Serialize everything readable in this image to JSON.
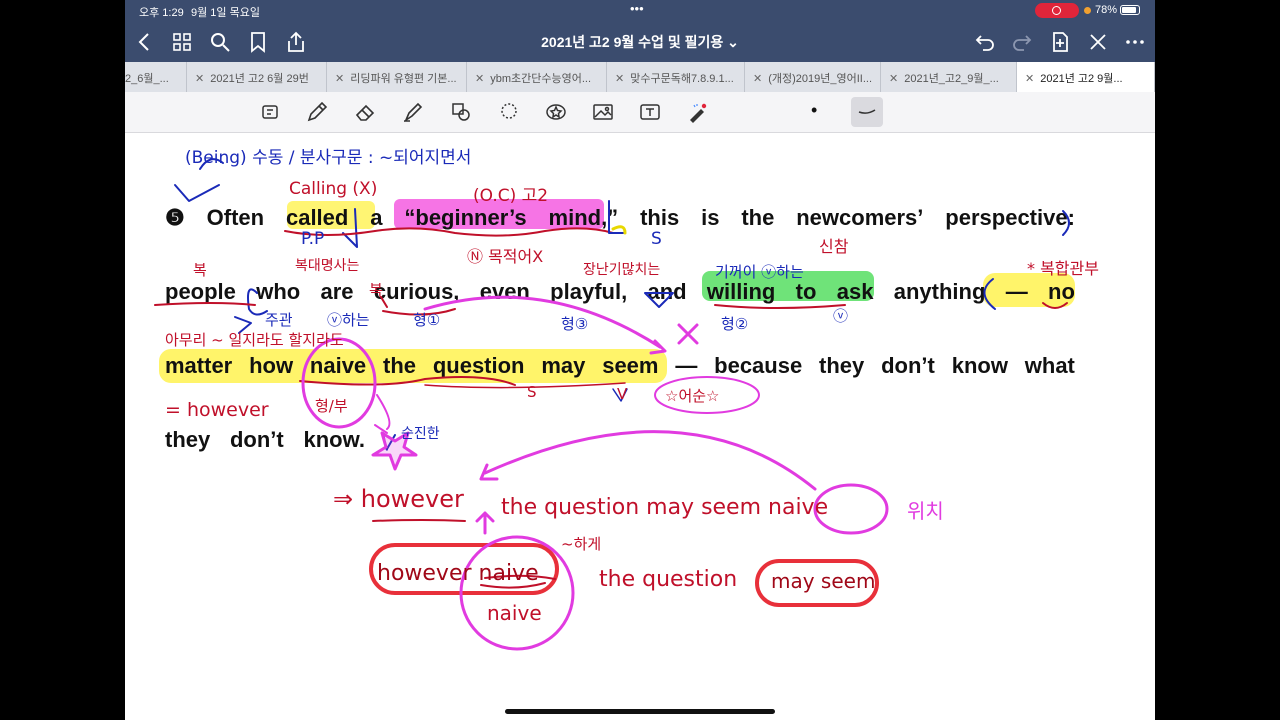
{
  "status": {
    "time": "오후 1:29",
    "date": "9월 1일 목요일",
    "battery": "78%",
    "dots": "•••"
  },
  "doc": {
    "title": "2021년 고2 9월 수업 및 필기용",
    "title_caret": "⌄"
  },
  "tabs": [
    {
      "label": "2_6월_..."
    },
    {
      "label": "2021년 고2 6월 29번"
    },
    {
      "label": "리딩파워 유형편 기본..."
    },
    {
      "label": "ybm초간단수능영어..."
    },
    {
      "label": "맞수구문독해7.8.9.1..."
    },
    {
      "label": "(개정)2019년_영어II..."
    },
    {
      "label": "2021년_고2_9월_..."
    },
    {
      "label": "2021년 고2 9월..."
    }
  ],
  "toolbar": {
    "dot": "•"
  },
  "passage": {
    "line1": [
      "❺",
      "Often",
      "called",
      "a",
      "“beginner’s",
      "mind,”",
      "this",
      "is",
      "the",
      "newcomers’",
      "perspective:"
    ],
    "line2": [
      "people",
      "who",
      "are",
      "curious,",
      "even",
      "playful,",
      "and",
      "willing",
      "to",
      "ask",
      "anything",
      "—",
      "no"
    ],
    "line3": [
      "matter",
      "how",
      "naive",
      "the",
      "question",
      "may",
      "seem",
      "—",
      "because",
      "they",
      "don’t",
      "know",
      "what"
    ],
    "line4": [
      "they",
      "don’t",
      "know."
    ]
  },
  "annotations": {
    "being": "(Being) 수동 / 분사구문 : ~되어지면서",
    "calling": "Calling (X)",
    "pp": "P.P",
    "oc": "(O.C) 고2",
    "n_mark": "Ⓝ 목적어X",
    "s_mark": "S",
    "shinchak": "신참",
    "bokhap": "* 복합관부",
    "buk": "복",
    "buk2": "복",
    "bokdae": "복대명사는",
    "jangnan": "장난기많치는",
    "kigeoi": "기꺼이 ⓥ하는",
    "juhwan": "주관",
    "vhaneun": "ⓥ하는",
    "hyeong1": "형①",
    "hyeong2": "형②",
    "hyeong3": "형③",
    "v_circ": "ⓥ",
    "amuri": "아무리 ~ 일지라도 할지라도",
    "however_eq": "= however",
    "hyeongbu": "형/부",
    "sunjinhan": "순진한",
    "s_small": "S",
    "v_small": "V",
    "dosun": "☆어순☆",
    "x_mark": "✕",
    "arrow_however": "⇒ however",
    "q_seem_naive": "the question may seem naive",
    "wichi": "위치",
    "hyeong_circ": "~하게",
    "however_naive": "however naive",
    "the_question": "the question",
    "may_seem": "may seem",
    "naive_bottom": "naive"
  },
  "colors": {
    "chrome": "#3b4c6e",
    "ink_blue": "#1a2ab8",
    "ink_red": "#c0102a",
    "ink_pink": "#e13be0",
    "highlight_yellow": "#fff35a",
    "highlight_magenta": "#f45ce0",
    "highlight_green": "#6be36b"
  },
  "icons": [
    "back-icon",
    "grid-icon",
    "search-icon",
    "bookmark-icon",
    "share-icon",
    "undo-icon",
    "redo-icon",
    "add-page-icon",
    "close-icon",
    "more-icon",
    "lasso-icon",
    "pen-icon",
    "eraser-icon",
    "highlighter-icon",
    "shapes-icon",
    "lasso-select-icon",
    "sticker-icon",
    "image-icon",
    "text-icon",
    "laser-icon"
  ]
}
